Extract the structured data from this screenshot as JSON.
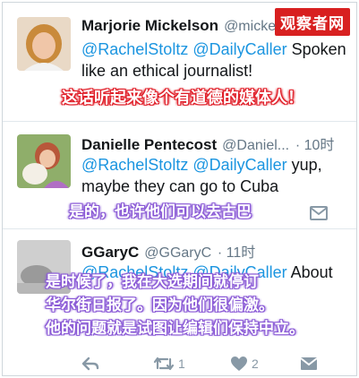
{
  "watermark": "观察者网",
  "tweets": [
    {
      "name": "Marjorie Mickelson",
      "handle": "@micke",
      "time": "",
      "mentions": "@RachelStoltz @DailyCaller",
      "text_tail": " Spoken",
      "text_line2": "like an ethical journalist!",
      "caption": "这话听起来像个有道德的媒体人！"
    },
    {
      "name": "Danielle Pentecost",
      "handle": "@Daniel...",
      "time": "· 10时",
      "mentions": "@RachelStoltz @DailyCaller",
      "text_tail": " yup,",
      "text_line2": "maybe they can go to Cuba",
      "caption": "是的，也许他们可以去古巴"
    },
    {
      "name": "GGaryC",
      "handle": "@GGaryC",
      "time": "· 11时",
      "mentions": "@RachelStoltz @DailyCaller",
      "text_tail": " About",
      "caption_lines": [
        "是时候了，我在大选期间就停订",
        "华尔街日报了。因为他们很偏激。",
        "他的问题就是试图让编辑们保持中立。"
      ],
      "retweet_count": "1",
      "like_count": "2"
    }
  ],
  "icons": [
    "reply-icon",
    "retweet-icon",
    "like-icon",
    "dm-icon"
  ],
  "colors": {
    "mention": "#1b95e0",
    "red_caption": "#e0202a",
    "purple_caption": "#8b5bd6",
    "icon": "#8899a6"
  }
}
